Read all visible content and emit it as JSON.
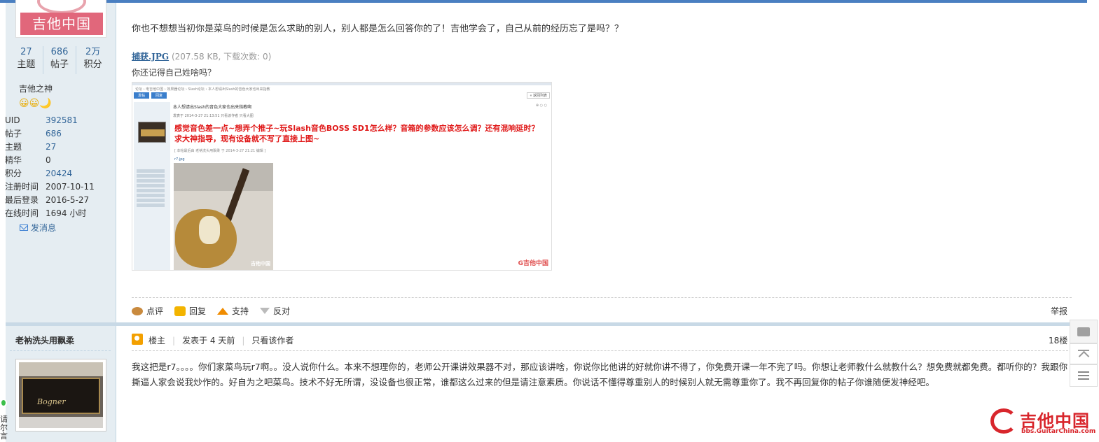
{
  "post1": {
    "author_card": {
      "logo_text": "吉他中国",
      "stats": [
        {
          "value": "27",
          "label": "主题"
        },
        {
          "value": "686",
          "label": "帖子"
        },
        {
          "value": "2万",
          "label": "积分"
        }
      ],
      "rank": "吉他之神",
      "rank_stars": "😀😀🌙",
      "info": [
        {
          "key": "UID",
          "value": "392581"
        },
        {
          "key": "帖子",
          "value": "686"
        },
        {
          "key": "主题",
          "value": "27"
        },
        {
          "key": "精华",
          "value": "0"
        },
        {
          "key": "积分",
          "value": "20424"
        },
        {
          "key": "注册时间",
          "value": "2007-10-11"
        },
        {
          "key": "最后登录",
          "value": "2016-5-27"
        },
        {
          "key": "在线时间",
          "value": "1694 小时"
        }
      ],
      "pm_label": "发消息"
    },
    "body_text": "你也不想想当初你是菜鸟的时候是怎么求助的别人，别人都是怎么回答你的了！吉他学会了，自己从前的经历忘了是吗？？",
    "attachment": {
      "filename": "捕获.JPG",
      "meta": "(207.58 KB, 下载次数: 0)"
    },
    "caption": "你还记得自己姓啥吗？",
    "embedded_screenshot": {
      "crumbs": "论坛 › 电吉他中国 › 效果器论坛 › Slash论坛 › 本人想请出Slash的音色大家也出来指教",
      "btn_post": "发帖",
      "btn_reply": "回复",
      "back": "« 返回列表",
      "thread_title": "本人想请出Slash的音色大家也出来指教啊",
      "meta": "发表于 2014-3-27 21:13:51  只看该作者  只看大图",
      "red_title": "感觉音色差一点~想弄个推子~玩Slash音色BOSS SD1怎么样？音箱的参数应该怎么调？还有混响延时？求大神指导，现有设备就不写了直接上图~",
      "edit_note": "[ 本帖最后由 老衲洗头用飘柔 于 2014-3-27 21:21 编辑 ]",
      "jpg_label": "r7.jpg",
      "watermark": "吉他中国",
      "watermark2": "G吉他中国",
      "icons": "⊕ ○ ○"
    },
    "actions": [
      {
        "label": "点评",
        "icon": "comment-icon"
      },
      {
        "label": "回复",
        "icon": "reply-icon"
      },
      {
        "label": "支持",
        "icon": "thumb-up-arrow-icon"
      },
      {
        "label": "反对",
        "icon": "thumb-down-arrow-icon"
      }
    ],
    "report": "举报"
  },
  "post2": {
    "author": "老衲洗头用飘柔",
    "avatar_text": "Bogner",
    "side_chars": "请\n尔\n言",
    "badge_label": "楼主",
    "posted": "发表于 4 天前",
    "only_author": "只看该作者",
    "floor": "18楼",
    "body_text": "我这把是r7。。。。你们家菜鸟玩r7啊。。没人说你什么。本来不想理你的，老师公开课讲效果器不对，那应该讲啥，你说你比他讲的好就你讲不得了，你免费开课一年不完了吗。你想让老师教什么就教什么？想免费就都免费。都听你的？我跟你撕逼人家会说我炒作的。好自为之吧菜鸟。技术不好无所谓，没设备也很正常，谁都这么过来的但是请注意素质。你说话不懂得尊重别人的时候别人就无需尊重你了。我不再回复你的帖子你谁随便发神经吧。"
  },
  "site_watermark": {
    "title": "吉他中国",
    "url": "bbs.GuitarChina.com"
  },
  "colors": {
    "sidebar_bg": "#e5edf2",
    "link": "#336699",
    "brand_red": "#d8262c",
    "accent_blue": "#4a7fc1"
  }
}
